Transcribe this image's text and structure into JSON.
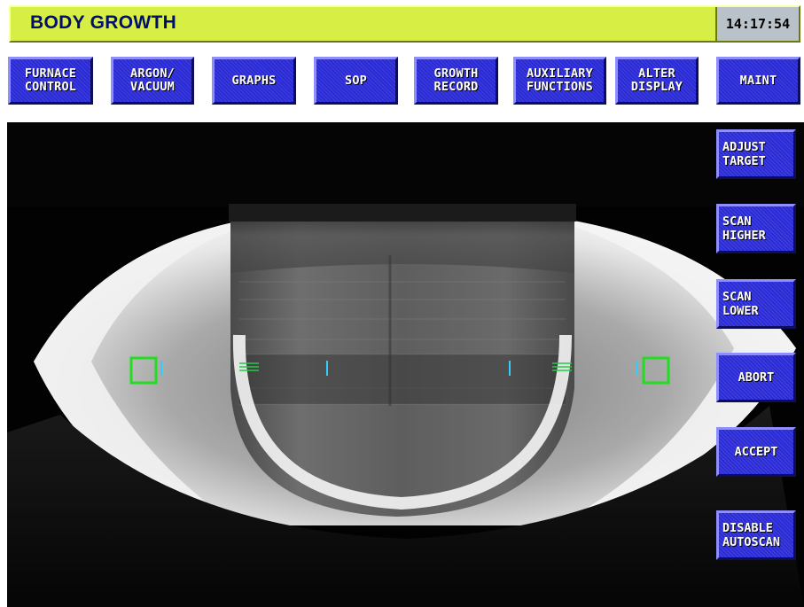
{
  "header": {
    "title": "BODY GROWTH",
    "clock": "14:17:54"
  },
  "menu": [
    {
      "label": "FURNACE\nCONTROL"
    },
    {
      "label": "ARGON/\nVACUUM"
    },
    {
      "label": "GRAPHS"
    },
    {
      "label": "SOP"
    },
    {
      "label": "GROWTH\nRECORD"
    },
    {
      "label": "AUXILIARY\nFUNCTIONS"
    },
    {
      "label": "ALTER\nDISPLAY"
    },
    {
      "label": "MAINT"
    }
  ],
  "side_menu": [
    {
      "label": "ADJUST\nTARGET"
    },
    {
      "label": "SCAN\nHIGHER"
    },
    {
      "label": "SCAN\nLOWER"
    },
    {
      "label": "ABORT"
    },
    {
      "label": "ACCEPT"
    },
    {
      "label": "DISABLE\nAUTOSCAN"
    }
  ],
  "colors": {
    "title_bar": "#d7ef45",
    "title_text": "#000e6e",
    "button_blue": "#2a2ad6",
    "target_marker": "#22dd22",
    "scan_tick": "#33ccff"
  }
}
